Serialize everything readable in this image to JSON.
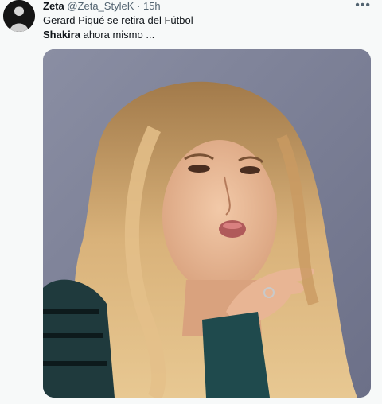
{
  "tweet": {
    "display_name": "Zeta",
    "handle": "@Zeta_StyleK",
    "separator": "·",
    "time": "15h",
    "more_label": "•••",
    "text_line1": "Gerard Piqué se retira del Fútbol",
    "text_line2_bold": "Shakira",
    "text_line2_rest": " ahora mismo ...",
    "avatar_icon": "avatar-silhouette-icon",
    "media_subject": "photo-image"
  }
}
